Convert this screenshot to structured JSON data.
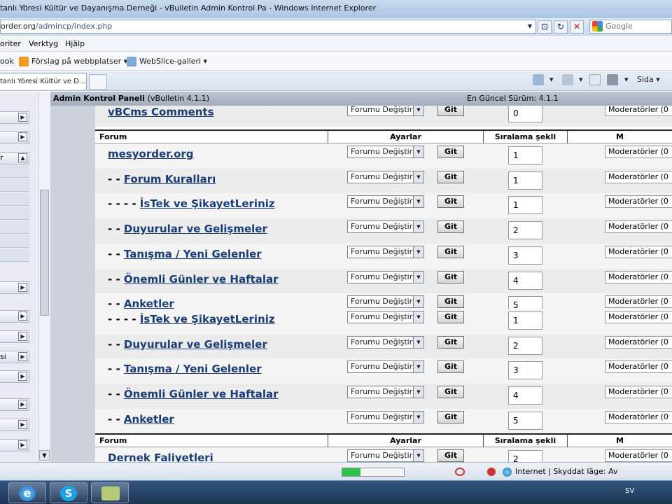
{
  "window": {
    "title": "tanlı Yöresi Kültür ve Dayanışma Derneği - vBulletin Admin Kontrol Pa - Windows Internet Explorer"
  },
  "address": {
    "url_domain": "order.org",
    "url_path": "/admincp/index.php",
    "search_placeholder": "Google"
  },
  "menu": {
    "items": [
      "oriter",
      "Verktyg",
      "Hjälp"
    ]
  },
  "favorites": {
    "items": [
      "ook",
      "Förslag på webbplatser ▾",
      "WebSlice-galleri ▾"
    ]
  },
  "tabs": {
    "active_label": "tanlı Yöresi Kültür ve D...",
    "page_label": "Sida ▾"
  },
  "sidebar": {
    "items": [
      "",
      "",
      "r",
      "",
      "",
      "",
      "si",
      "",
      "",
      "",
      ""
    ]
  },
  "header": {
    "title": "Admin Kontrol Paneli",
    "version": "(vBulletin 4.1.1)",
    "latest": "En Güncel Sürüm: 4.1.1"
  },
  "columns": {
    "forum": "Forum",
    "settings": "Ayarlar",
    "order": "Sıralama şekli",
    "moderators": "M"
  },
  "controls": {
    "select_value": "Forumu Değiştir",
    "go_label": "Git",
    "moderator_value": "Moderatörler (0"
  },
  "top_row": {
    "name": "vBCms Comments",
    "prefix": "",
    "order": "0"
  },
  "rows_a": [
    {
      "prefix": "",
      "name": "mesyorder.org",
      "order": "1"
    },
    {
      "prefix": "- - ",
      "name": "Forum Kuralları",
      "order": "1"
    },
    {
      "prefix": "- - - - ",
      "name": "İsTek ve ŞikayetLeriniz",
      "order": "1"
    },
    {
      "prefix": "- - ",
      "name": "Duyurular ve Gelişmeler",
      "order": "2"
    },
    {
      "prefix": "- - ",
      "name": "Tanışma / Yeni Gelenler",
      "order": "3"
    },
    {
      "prefix": "- - ",
      "name": "Önemli Günler ve Haftalar",
      "order": "4"
    },
    {
      "prefix": "- - ",
      "name": "Anketler",
      "order": "5"
    }
  ],
  "rows_b": [
    {
      "prefix": "- - - - ",
      "name": "İsTek ve ŞikayetLeriniz",
      "order": "1"
    },
    {
      "prefix": "- - ",
      "name": "Duyurular ve Gelişmeler",
      "order": "2"
    },
    {
      "prefix": "- - ",
      "name": "Tanışma / Yeni Gelenler",
      "order": "3"
    },
    {
      "prefix": "- - ",
      "name": "Önemli Günler ve Haftalar",
      "order": "4"
    },
    {
      "prefix": "- - ",
      "name": "Anketler",
      "order": "5"
    }
  ],
  "bottom_row": {
    "prefix": "",
    "name": "Dernek Faliyetleri",
    "order": "2"
  },
  "statusbar": {
    "zone": "Internet | Skyddat läge: Av",
    "progress": 0.3
  },
  "taskbar": {
    "lang": "SV"
  },
  "colors": {
    "link": "#1a3d7a",
    "progress": "#2cc24a"
  }
}
